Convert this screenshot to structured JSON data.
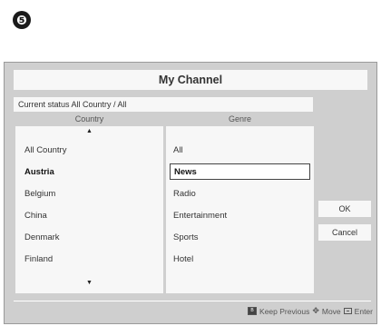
{
  "step_badge": "❺",
  "dialog": {
    "title": "My Channel"
  },
  "status": {
    "text": "Current status All Country / All"
  },
  "columns": {
    "country_header": "Country",
    "genre_header": "Genre"
  },
  "country_list": {
    "scroll_up": "▲",
    "scroll_down": "▼",
    "items": [
      {
        "label": "All Country"
      },
      {
        "label": "Austria"
      },
      {
        "label": "Belgium"
      },
      {
        "label": "China"
      },
      {
        "label": "Denmark"
      },
      {
        "label": "Finland"
      }
    ]
  },
  "genre_list": {
    "items": [
      {
        "label": "All"
      },
      {
        "label": "News"
      },
      {
        "label": "Radio"
      },
      {
        "label": "Entertainment"
      },
      {
        "label": "Sports"
      },
      {
        "label": "Hotel"
      }
    ]
  },
  "buttons": {
    "ok": "OK",
    "cancel": "Cancel"
  },
  "help": {
    "keep_key": "B",
    "keep_label": "Keep Previous",
    "move_icon": "move-arrows-icon",
    "move_label": "Move",
    "enter_icon": "enter-key-icon",
    "enter_label": "Enter"
  }
}
